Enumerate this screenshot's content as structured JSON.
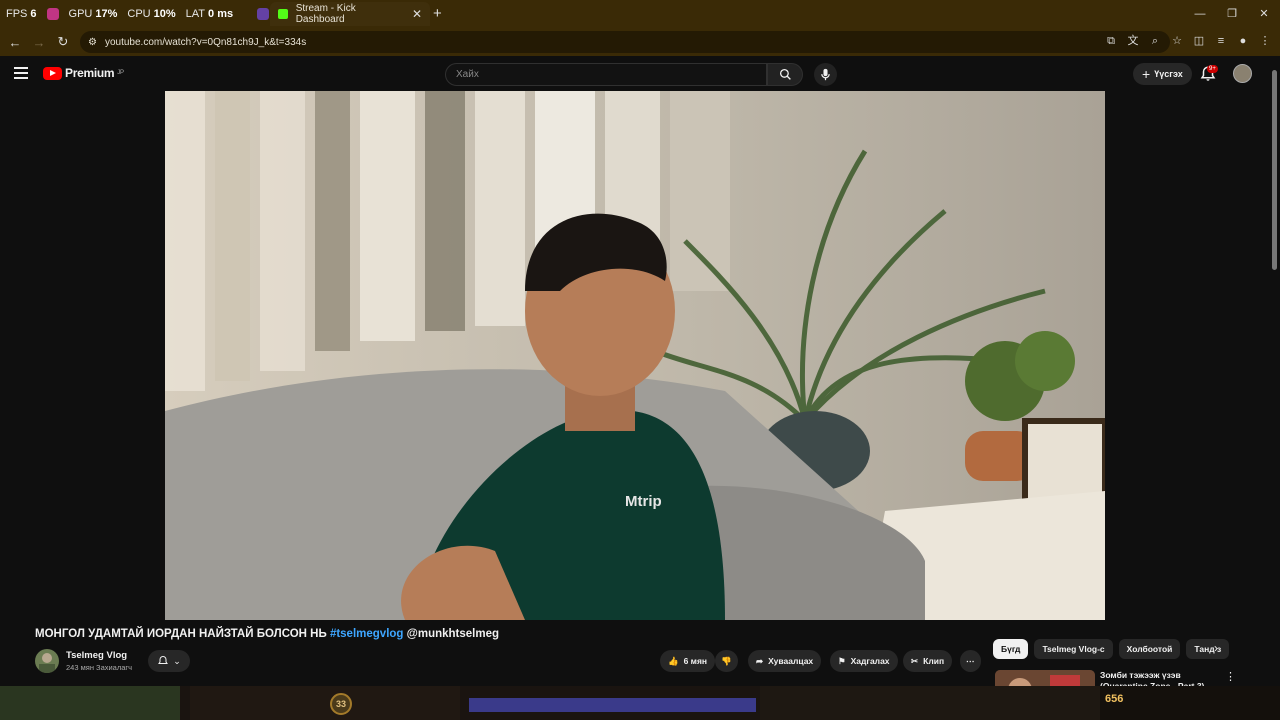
{
  "overlay_stats": [
    {
      "key": "FPS",
      "value": "6"
    },
    {
      "key": "GPU",
      "value": "17%"
    },
    {
      "key": "CPU",
      "value": "10%"
    },
    {
      "key": "LAT",
      "value": "0 ms"
    }
  ],
  "browser": {
    "active_tab_title": "Stream - Kick Dashboard",
    "url": "youtube.com/watch?v=0Qn81ch9J_k&t=334s",
    "accent": "#3a2a06"
  },
  "youtube": {
    "logo_text": "Premium",
    "logo_sup": "JP",
    "search_placeholder": "Хайх",
    "create_label": "Үүсгэх",
    "notif_badge": "9+",
    "video": {
      "title": "МОНГОЛ УДАМТАЙ ИОРДАН НАЙЗТАЙ БОЛСОН НЬ",
      "hashtag": "#tselmegvlog",
      "mention": "@munkhtselmeg",
      "shirt_logo": "Mtrip"
    },
    "channel": {
      "name": "Tselmeg Vlog",
      "subscribers": "243 мян Захиалагч"
    },
    "actions": {
      "likes": "6 мян",
      "share": "Хуваалцах",
      "save": "Хадгалах",
      "clip": "Клип"
    },
    "chips": [
      "Бүгд",
      "Tselmeg Vlog-с",
      "Холбоотой",
      "Танд з"
    ],
    "recommendation": {
      "title": "Зомби тэжээж үзэв (Quarantine Zone - Part 3)"
    }
  },
  "bottom_overlay": {
    "level": "33",
    "gold": "656"
  }
}
